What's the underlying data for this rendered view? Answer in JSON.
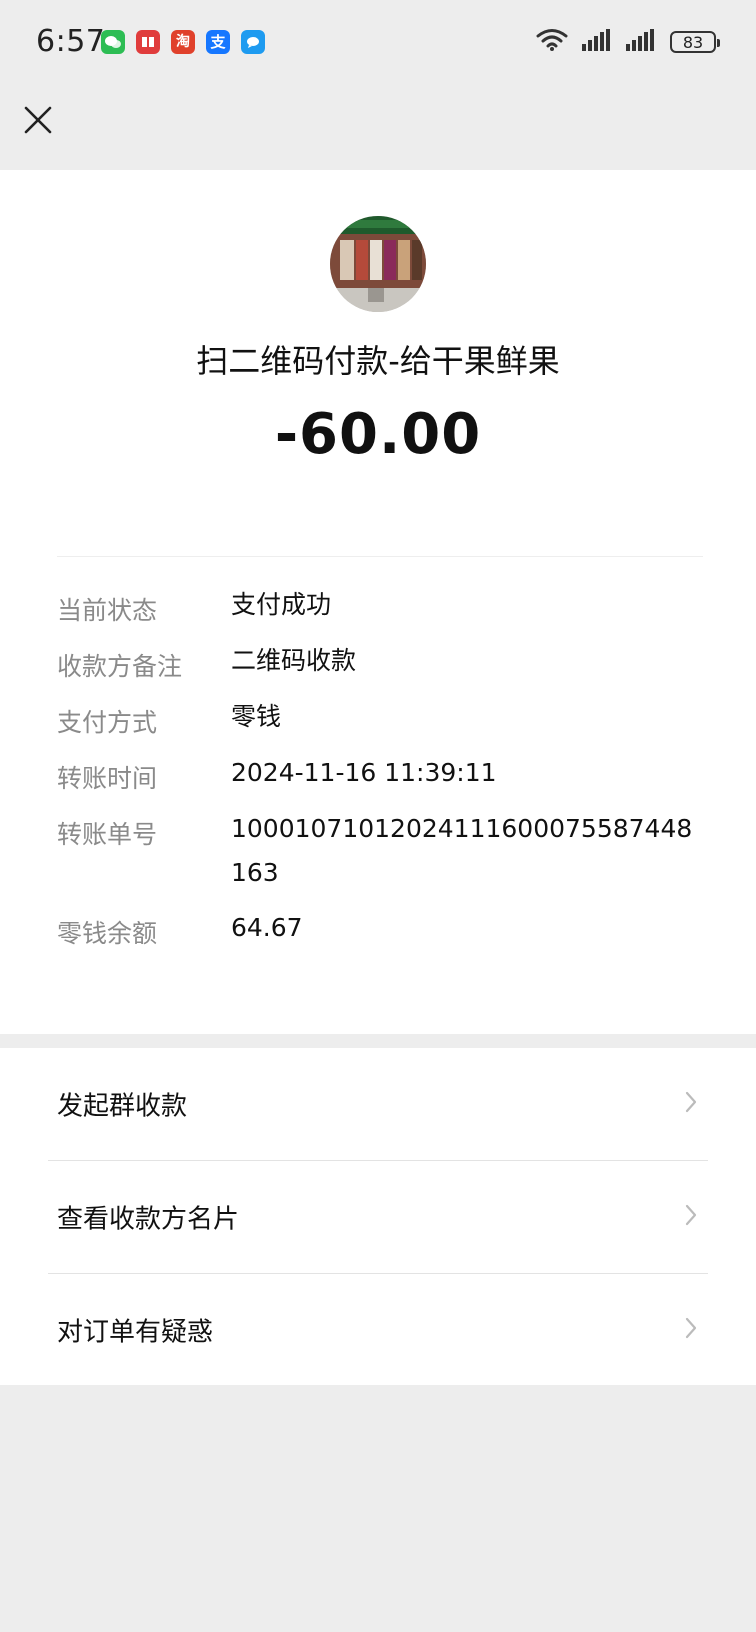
{
  "status_bar": {
    "time": "6:57",
    "battery": "83",
    "app_icons": [
      {
        "name": "wechat-icon",
        "color": "#2dbd54",
        "glyph": "●"
      },
      {
        "name": "book-icon",
        "color": "#e03c3c",
        "glyph": "■"
      },
      {
        "name": "taobao-icon",
        "color": "#e0412b",
        "glyph": "淘"
      },
      {
        "name": "alipay-icon",
        "color": "#1677ff",
        "glyph": "支"
      },
      {
        "name": "message-icon",
        "color": "#1e9bf0",
        "glyph": "●"
      }
    ]
  },
  "header": {
    "close_icon": "close-icon"
  },
  "payment": {
    "title": "扫二维码付款-给干果鲜果",
    "amount": "-60.00"
  },
  "details": [
    {
      "label": "当前状态",
      "value": "支付成功"
    },
    {
      "label": "收款方备注",
      "value": "二维码收款"
    },
    {
      "label": "支付方式",
      "value": "零钱"
    },
    {
      "label": "转账时间",
      "value": "2024-11-16 11:39:11"
    },
    {
      "label": "转账单号",
      "value": "10001071012024111600075587448163"
    },
    {
      "label": "零钱余额",
      "value": "64.67"
    }
  ],
  "menu": [
    {
      "label": "发起群收款"
    },
    {
      "label": "查看收款方名片"
    },
    {
      "label": "对订单有疑惑"
    }
  ],
  "colors": {
    "background": "#ededed",
    "card": "#ffffff",
    "label_gray": "#8a8a8a",
    "text": "#111111"
  }
}
